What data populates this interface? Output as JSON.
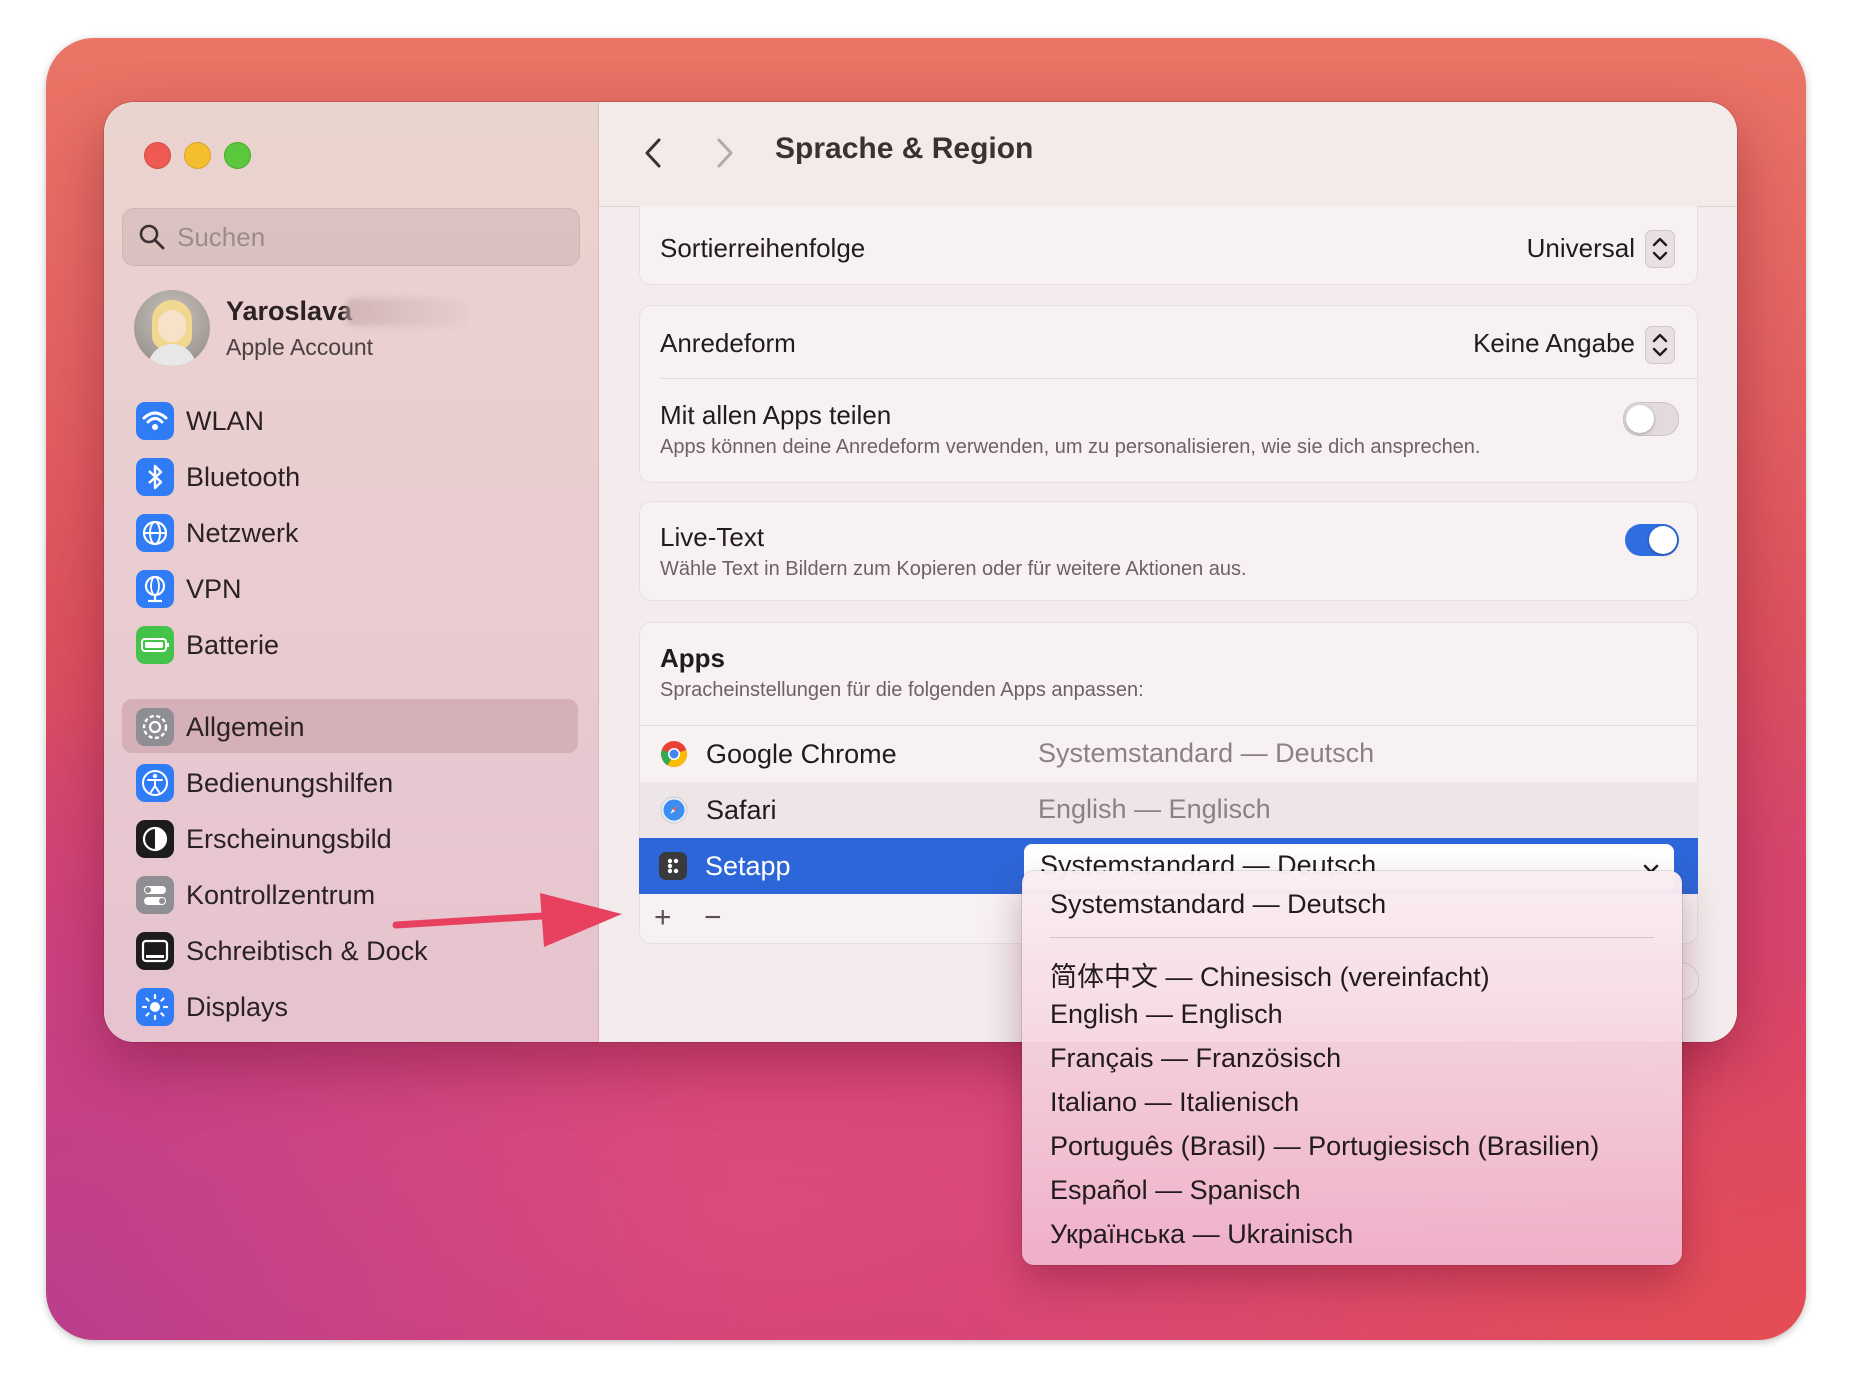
{
  "window": {
    "title": "Sprache & Region"
  },
  "sidebar": {
    "search_placeholder": "Suchen",
    "account": {
      "name": "Yaroslava",
      "subtitle": "Apple Account"
    },
    "items": [
      {
        "label": "WLAN",
        "icon": "wifi-icon",
        "color": "#2f7cf6"
      },
      {
        "label": "Bluetooth",
        "icon": "bluetooth-icon",
        "color": "#2f7cf6"
      },
      {
        "label": "Netzwerk",
        "icon": "globe-icon",
        "color": "#2f7cf6"
      },
      {
        "label": "VPN",
        "icon": "vpn-globe-icon",
        "color": "#2f7cf6"
      },
      {
        "label": "Batterie",
        "icon": "battery-icon",
        "color": "#45c24a"
      },
      {
        "label": "Allgemein",
        "icon": "gear-icon",
        "color": "#8e8e93",
        "active": true
      },
      {
        "label": "Bedienungshilfen",
        "icon": "accessibility-icon",
        "color": "#2f7cf6"
      },
      {
        "label": "Erscheinungsbild",
        "icon": "appearance-icon",
        "color": "#1c1c1e"
      },
      {
        "label": "Kontrollzentrum",
        "icon": "control-center-icon",
        "color": "#8e8e93"
      },
      {
        "label": "Schreibtisch & Dock",
        "icon": "dock-icon",
        "color": "#1c1c1e"
      },
      {
        "label": "Displays",
        "icon": "sun-icon",
        "color": "#2f7cf6"
      }
    ]
  },
  "settings": {
    "sort_order": {
      "label": "Sortierreihenfolge",
      "value": "Universal"
    },
    "address": {
      "label": "Anredeform",
      "value": "Keine Angabe"
    },
    "share_apps": {
      "label": "Mit allen Apps teilen",
      "description": "Apps können deine Anredeform verwenden, um zu personalisieren, wie sie dich ansprechen.",
      "enabled": false
    },
    "live_text": {
      "label": "Live-Text",
      "description": "Wähle Text in Bildern zum Kopieren oder für weitere Aktionen aus.",
      "enabled": true
    }
  },
  "apps": {
    "title": "Apps",
    "subtitle": "Spracheinstellungen für die folgenden Apps anpassen:",
    "rows": [
      {
        "name": "Google Chrome",
        "language": "Systemstandard — Deutsch",
        "icon": "chrome-icon"
      },
      {
        "name": "Safari",
        "language": "English — Englisch",
        "icon": "safari-icon"
      },
      {
        "name": "Setapp",
        "language": "Systemstandard — Deutsch",
        "icon": "setapp-icon",
        "selected": true
      }
    ],
    "add_label": "+",
    "remove_label": "−"
  },
  "language_menu": {
    "selected": "Systemstandard — Deutsch",
    "options": [
      "Systemstandard — Deutsch",
      "简体中文 — Chinesisch (vereinfacht)",
      "English — Englisch",
      "Français — Französisch",
      "Italiano — Italienisch",
      "Português (Brasil) — Portugiesisch (Brasilien)",
      "Español — Spanisch",
      "Українська — Ukrainisch"
    ]
  },
  "colors": {
    "accent": "#2d66d8",
    "annotation_arrow": "#e8405f"
  }
}
